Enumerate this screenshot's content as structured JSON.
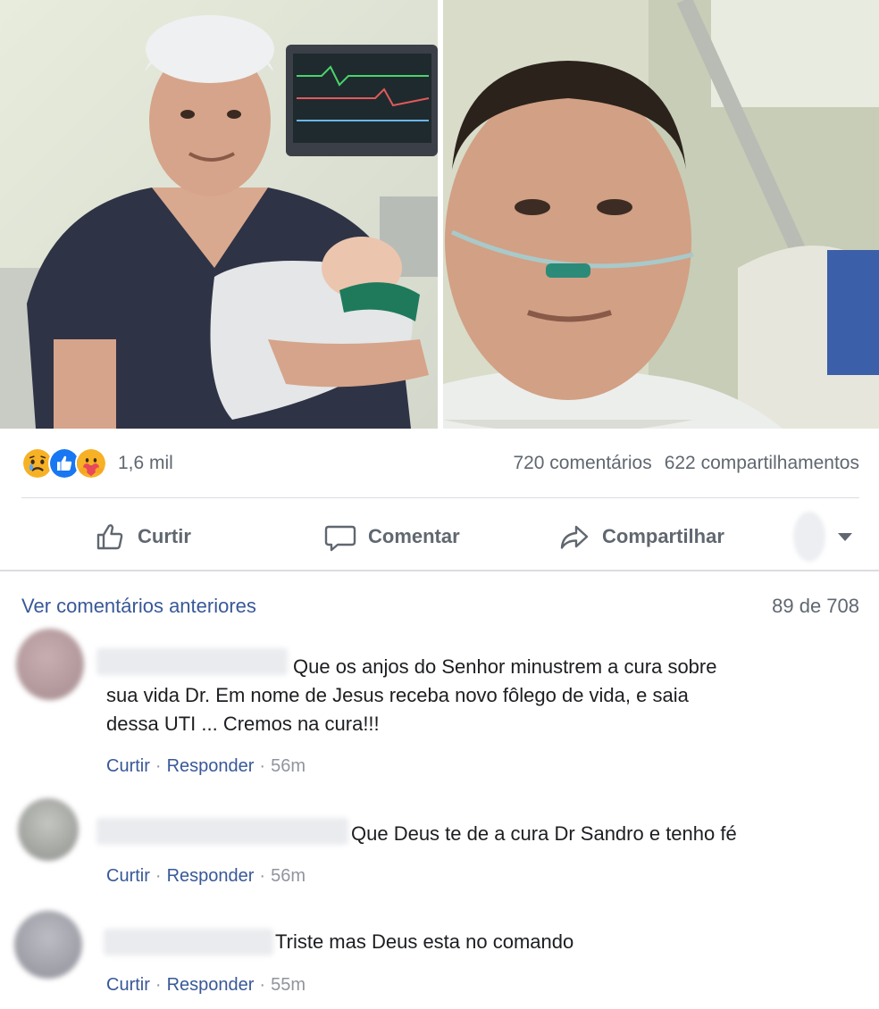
{
  "post": {
    "reactions": {
      "icons": [
        "sad-emoji",
        "like-thumb",
        "care-hug-emoji"
      ],
      "count": "1,6 mil",
      "colors": {
        "sad": "#f7b125",
        "like": "#1877f2",
        "care": "#f7b125",
        "heart": "#e9485b"
      }
    },
    "comments_count": "720 comentários",
    "shares_count": "622 compartilhamentos",
    "actions": {
      "like": "Curtir",
      "comment": "Comentar",
      "share": "Compartilhar"
    }
  },
  "comments_section": {
    "view_previous": "Ver comentários anteriores",
    "pager": "89 de 708",
    "items": [
      {
        "text": "Que os anjos do Senhor minustrem a cura sobre",
        "text_line2": "sua vida Dr. Em nome de Jesus receba novo fôlego de vida, e saia",
        "text_line3": "dessa UTI ... Cremos na cura!!!",
        "like": "Curtir",
        "reply": "Responder",
        "time": "56m"
      },
      {
        "text": "Que Deus te de a cura Dr Sandro e tenho fé",
        "like": "Curtir",
        "reply": "Responder",
        "time": "56m"
      },
      {
        "text": "Triste mas Deus esta no comando",
        "like": "Curtir",
        "reply": "Responder",
        "time": "55m"
      }
    ]
  },
  "theme": {
    "link": "#385898",
    "muted": "#606770",
    "divider": "#dadde1"
  }
}
